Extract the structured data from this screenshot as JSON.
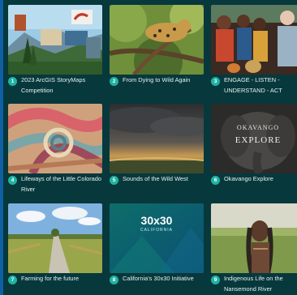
{
  "gallery": {
    "items": [
      {
        "number": "1",
        "title": "2023 ArcGIS StoryMaps Competition"
      },
      {
        "number": "2",
        "title": "From Dying to Wild Again"
      },
      {
        "number": "3",
        "title": "ENGAGE - LISTEN - UNDERSTAND - ACT"
      },
      {
        "number": "4",
        "title": "Lifeways of the Little Colorado River"
      },
      {
        "number": "5",
        "title": "Sounds of the Wild West"
      },
      {
        "number": "6",
        "title": "Okavango Explore"
      },
      {
        "number": "7",
        "title": "Farming for the future"
      },
      {
        "number": "8",
        "title": "California's 30x30 Initiative"
      },
      {
        "number": "9",
        "title": "Indigenous Life on the Nansemond River"
      }
    ]
  },
  "thumbnails": {
    "okavango_text_1": "OKAVANGO",
    "okavango_text_2": "EXPLORE",
    "cal_text_1": "30x30",
    "cal_text_2": "CALIFORNIA"
  },
  "colors": {
    "panel_background": "#07383c",
    "number_badge": "#1fb3a3",
    "caption_text": "#e8f2f1",
    "outer_frame": "#0e5fa3"
  }
}
